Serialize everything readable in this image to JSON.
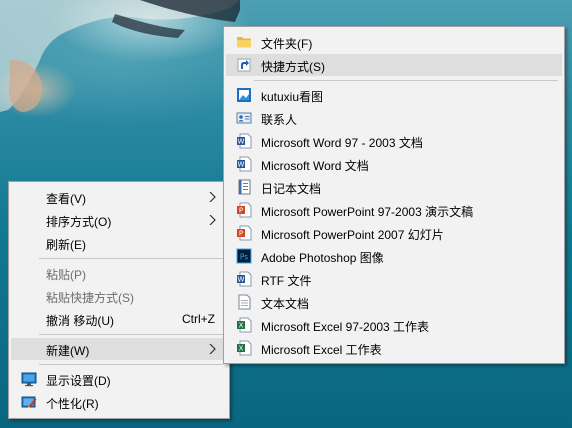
{
  "left_menu": {
    "view": "查看(V)",
    "sort": "排序方式(O)",
    "refresh": "刷新(E)",
    "paste": "粘贴(P)",
    "paste_shortcut": "粘贴快捷方式(S)",
    "undo": "撤消 移动(U)",
    "undo_shortcut": "Ctrl+Z",
    "new": "新建(W)",
    "display": "显示设置(D)",
    "personalize": "个性化(R)"
  },
  "new_submenu": {
    "folder": "文件夹(F)",
    "shortcut": "快捷方式(S)",
    "kutuxiu": "kutuxiu看图",
    "contact": "联系人",
    "word97": "Microsoft Word 97 - 2003 文档",
    "word": "Microsoft Word 文档",
    "journal": "日记本文档",
    "ppt97": "Microsoft PowerPoint 97-2003 演示文稿",
    "ppt2007": "Microsoft PowerPoint 2007 幻灯片",
    "photoshop": "Adobe Photoshop 图像",
    "rtf": "RTF 文件",
    "text": "文本文档",
    "excel97": "Microsoft Excel 97-2003 工作表",
    "excel": "Microsoft Excel 工作表"
  },
  "colors": {
    "word_blue": "#2b579a",
    "ppt_orange": "#d24726",
    "excel_green": "#217346",
    "ps_navy": "#001d34",
    "hover_gray": "#dedede"
  }
}
